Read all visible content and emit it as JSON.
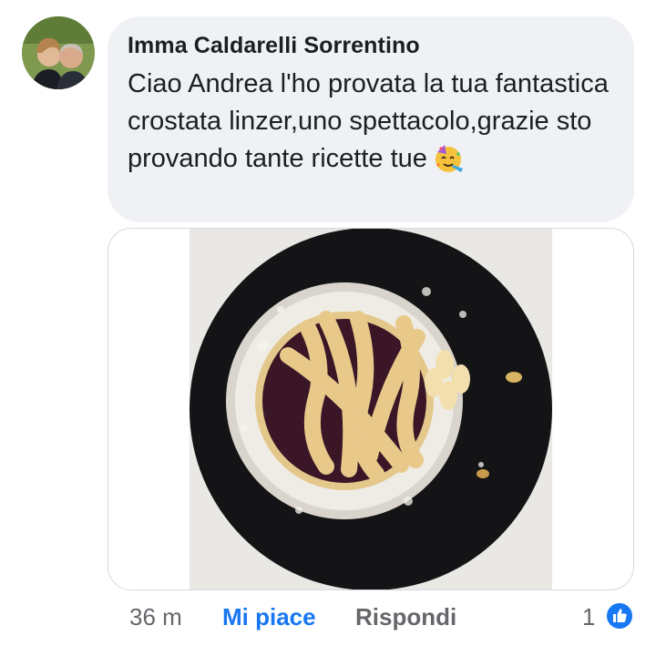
{
  "comment": {
    "author": "Imma Caldarelli Sorrentino",
    "text": "Ciao Andrea l'ho provata la tua fantastica crostata linzer,uno spettacolo,grazie sto provando tante ricette tue",
    "emoji": "partying-face"
  },
  "attachment": {
    "type": "photo"
  },
  "actions": {
    "time": "36 m",
    "like_label": "Mi piace",
    "reply_label": "Rispondi",
    "reaction_count": "1",
    "reaction_icon": "like-icon"
  },
  "colors": {
    "bubble": "#eff1f4",
    "like_blue": "#1877f2",
    "secondary_text": "#65676b"
  }
}
